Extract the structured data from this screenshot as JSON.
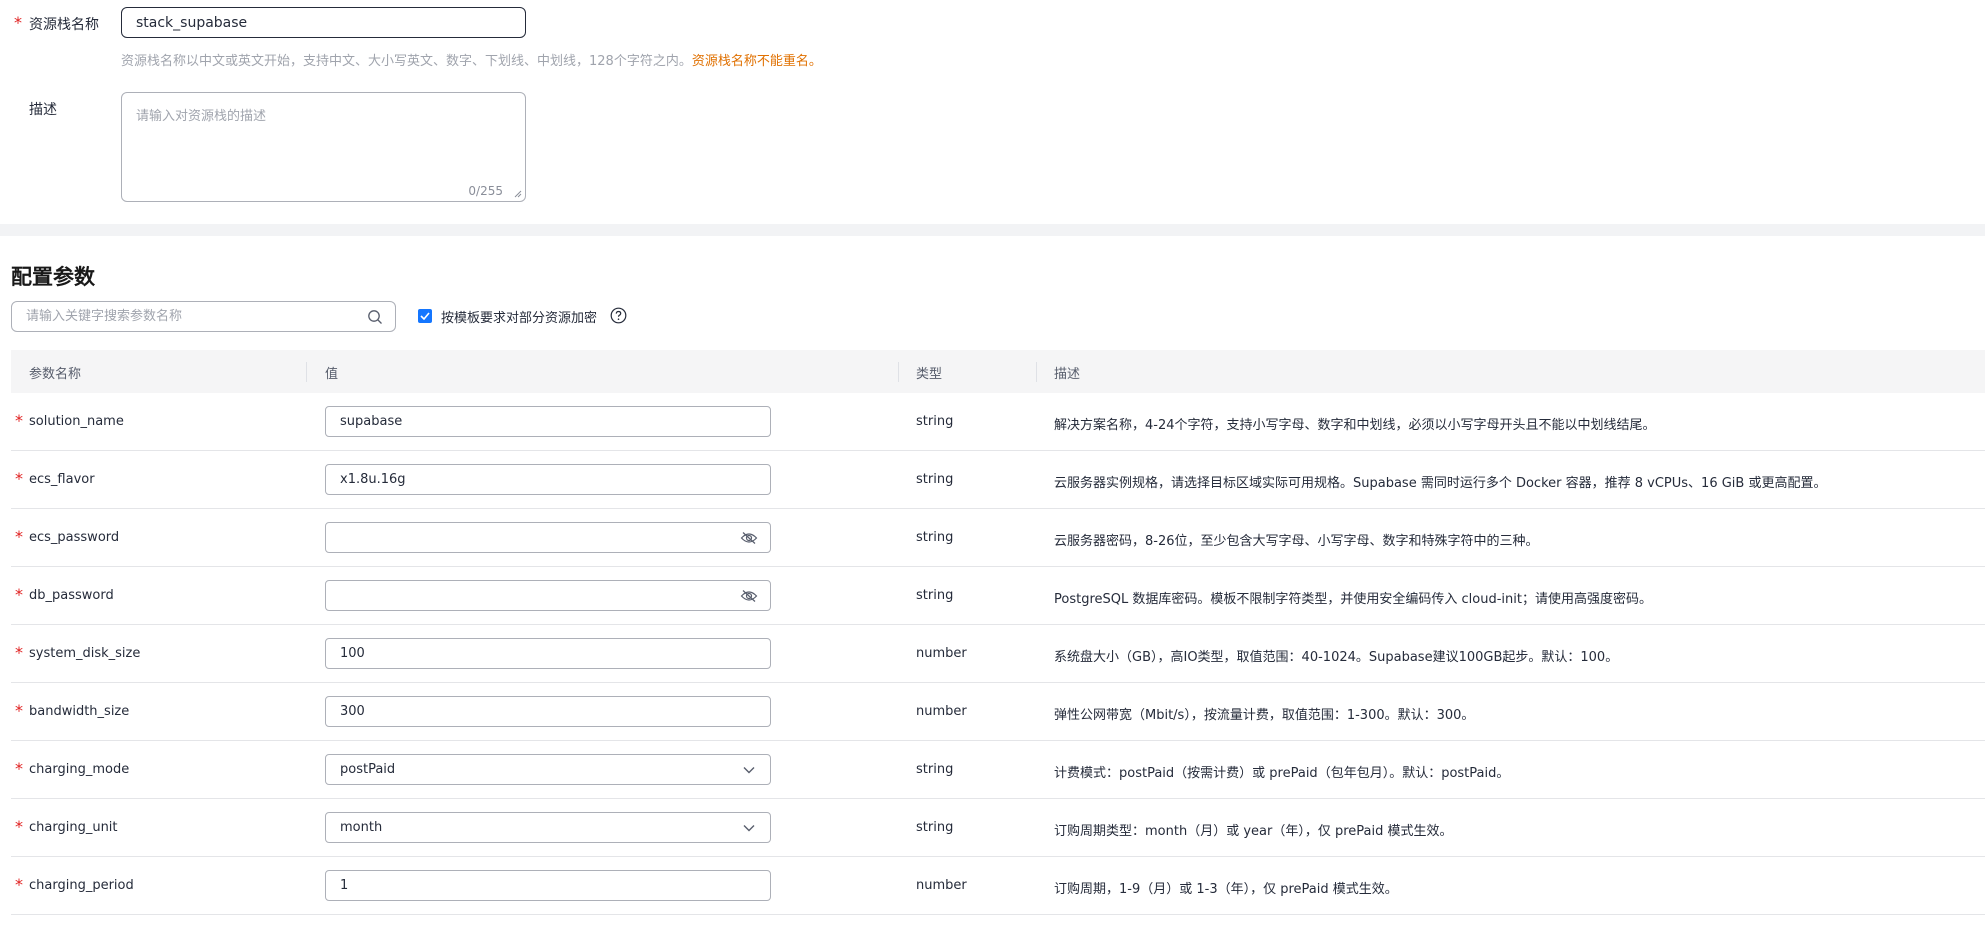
{
  "basic": {
    "stack_name_label": "资源栈名称",
    "stack_name_value": "stack_supabase",
    "stack_name_hint": "资源栈名称以中文或英文开始，支持中文、大小写英文、数字、下划线、中划线，128个字符之内。",
    "stack_name_hint_warn": "资源栈名称不能重名。",
    "description_label": "描述",
    "description_placeholder": "请输入对资源栈的描述",
    "description_counter": "0/255"
  },
  "config": {
    "title": "配置参数",
    "search_placeholder": "请输入关键字搜索参数名称",
    "encrypt_label": "按模板要求对部分资源加密",
    "columns": {
      "name": "参数名称",
      "value": "值",
      "type": "类型",
      "description": "描述"
    },
    "params": [
      {
        "name": "solution_name",
        "value": "supabase",
        "type": "string",
        "description": "解决方案名称，4-24个字符，支持小写字母、数字和中划线，必须以小写字母开头且不能以中划线结尾。"
      },
      {
        "name": "ecs_flavor",
        "value": "x1.8u.16g",
        "type": "string",
        "description": "云服务器实例规格，请选择目标区域实际可用规格。Supabase 需同时运行多个 Docker 容器，推荐 8 vCPUs、16 GiB 或更高配置。"
      },
      {
        "name": "ecs_password",
        "value": "",
        "type": "string",
        "description": "云服务器密码，8-26位，至少包含大写字母、小写字母、数字和特殊字符中的三种。"
      },
      {
        "name": "db_password",
        "value": "",
        "type": "string",
        "description": "PostgreSQL 数据库密码。模板不限制字符类型，并使用安全编码传入 cloud-init；请使用高强度密码。"
      },
      {
        "name": "system_disk_size",
        "value": "100",
        "type": "number",
        "description": "系统盘大小（GB），高IO类型，取值范围：40-1024。Supabase建议100GB起步。默认：100。"
      },
      {
        "name": "bandwidth_size",
        "value": "300",
        "type": "number",
        "description": "弹性公网带宽（Mbit/s），按流量计费，取值范围：1-300。默认：300。"
      },
      {
        "name": "charging_mode",
        "value": "postPaid",
        "type": "string",
        "description": "计费模式：postPaid（按需计费）或 prePaid（包年包月）。默认：postPaid。"
      },
      {
        "name": "charging_unit",
        "value": "month",
        "type": "string",
        "description": "订购周期类型：month（月）或 year（年），仅 prePaid 模式生效。"
      },
      {
        "name": "charging_period",
        "value": "1",
        "type": "number",
        "description": "订购周期，1-9（月）或 1-3（年），仅 prePaid 模式生效。"
      }
    ]
  },
  "colors": {
    "required": "#e02020",
    "warning": "#e07000",
    "accent": "#1476ff"
  },
  "icons": [
    "search-icon",
    "check-icon",
    "help-icon",
    "eye-off-icon",
    "chevron-down-icon",
    "resize-icon"
  ]
}
